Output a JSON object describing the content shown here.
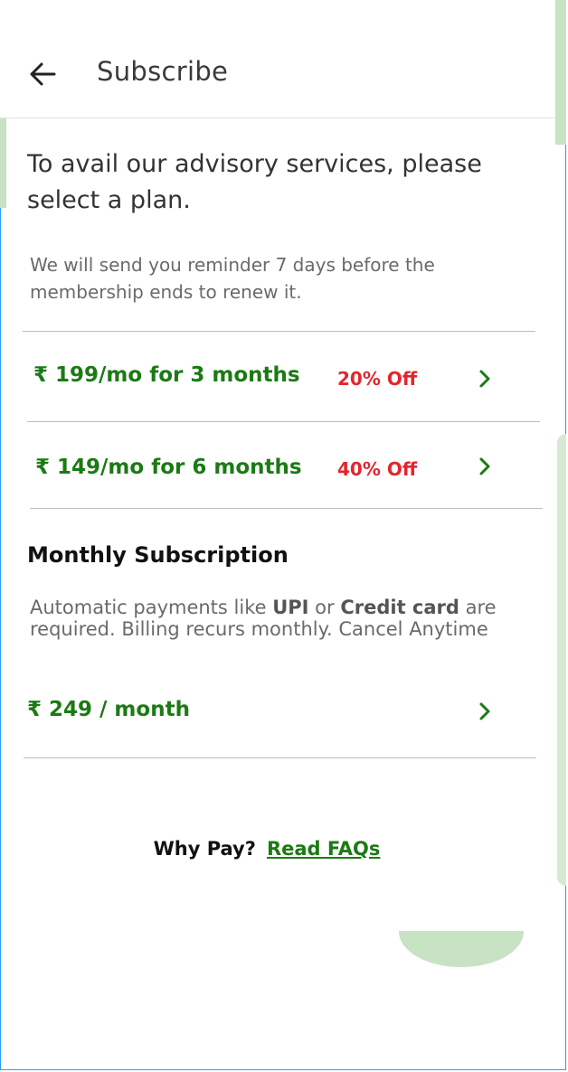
{
  "header": {
    "title": "Subscribe"
  },
  "intro": {
    "text": "To avail our advisory services, please select a plan.",
    "reminder": "We will send you reminder 7 days before the membership ends to renew it."
  },
  "plans": [
    {
      "price": "₹ 199/mo for 3 months",
      "discount": "20% Off"
    },
    {
      "price": "₹ 149/mo for 6 months",
      "discount": "40% Off"
    }
  ],
  "monthly": {
    "title": "Monthly Subscription",
    "desc_part1": "Automatic payments like ",
    "desc_bold1": "UPI",
    "desc_part2": " or ",
    "desc_bold2": "Credit card",
    "desc_part3": " are required. Billing recurs monthly. Cancel Anytime",
    "price": "₹ 249 / month"
  },
  "footer": {
    "why_pay": "Why Pay?",
    "faq_link": "Read FAQs"
  },
  "colors": {
    "price_green": "#1b7a14",
    "discount_red": "#e2262d",
    "accent_blob": "#c8e2c4"
  },
  "icons": {
    "back": "arrow-left-icon",
    "chevron": "chevron-right-icon"
  }
}
